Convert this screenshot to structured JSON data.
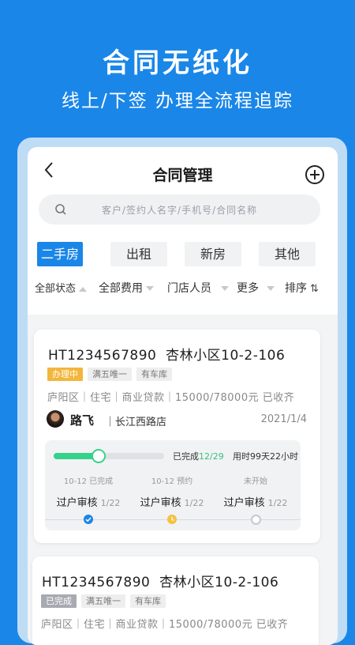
{
  "hero": {
    "title": "合同无纸化",
    "subtitle": "线上/下签  办理全流程追踪"
  },
  "nav": {
    "title": "合同管理",
    "back_icon": "chevron-left-icon",
    "add_icon": "plus-circle-icon"
  },
  "search": {
    "placeholder": "客户/签约人名字/手机号/合同名称",
    "icon": "search-icon"
  },
  "category_tabs": [
    {
      "label": "二手房",
      "active": true
    },
    {
      "label": "出租",
      "active": false
    },
    {
      "label": "新房",
      "active": false
    },
    {
      "label": "其他",
      "active": false
    }
  ],
  "filters": [
    {
      "label": "全部状态"
    },
    {
      "label": "全部费用"
    },
    {
      "label": "门店人员"
    },
    {
      "label": "更多"
    },
    {
      "label": "排序"
    }
  ],
  "contracts": [
    {
      "code": "HT1234567890",
      "name": "杏林小区10-2-106",
      "status": "办理中",
      "tags": [
        "满五唯一",
        "有车库"
      ],
      "meta": "庐阳区｜住宅｜商业贷款｜15000/78000元 已收齐",
      "agent": "路飞",
      "store": "长江西路店",
      "date": "2021/1/4",
      "progress": {
        "done_label": "已完成",
        "done_count": "12/29",
        "done_fraction": 0.41,
        "elapsed": "用时99天22小时",
        "steps": [
          {
            "date": "10-12 已完成",
            "name": "过户审核",
            "ratio": "1/22",
            "state": "done"
          },
          {
            "date": "10-12 预约",
            "name": "过户审核",
            "ratio": "1/22",
            "state": "doing"
          },
          {
            "date": "未开始",
            "name": "过户审核",
            "ratio": "1/22",
            "state": "todo"
          }
        ]
      }
    },
    {
      "code": "HT1234567890",
      "name": "杏林小区10-2-106",
      "status": "已完成",
      "tags": [
        "满五唯一",
        "有车库"
      ],
      "meta": "庐阳区｜住宅｜商业贷款｜15000/78000元 已收齐"
    }
  ],
  "colors": {
    "brand": "#1a86e8",
    "status_in_progress": "#f2b63c",
    "status_done": "#a8aab2",
    "progress_green": "#35d28b"
  }
}
